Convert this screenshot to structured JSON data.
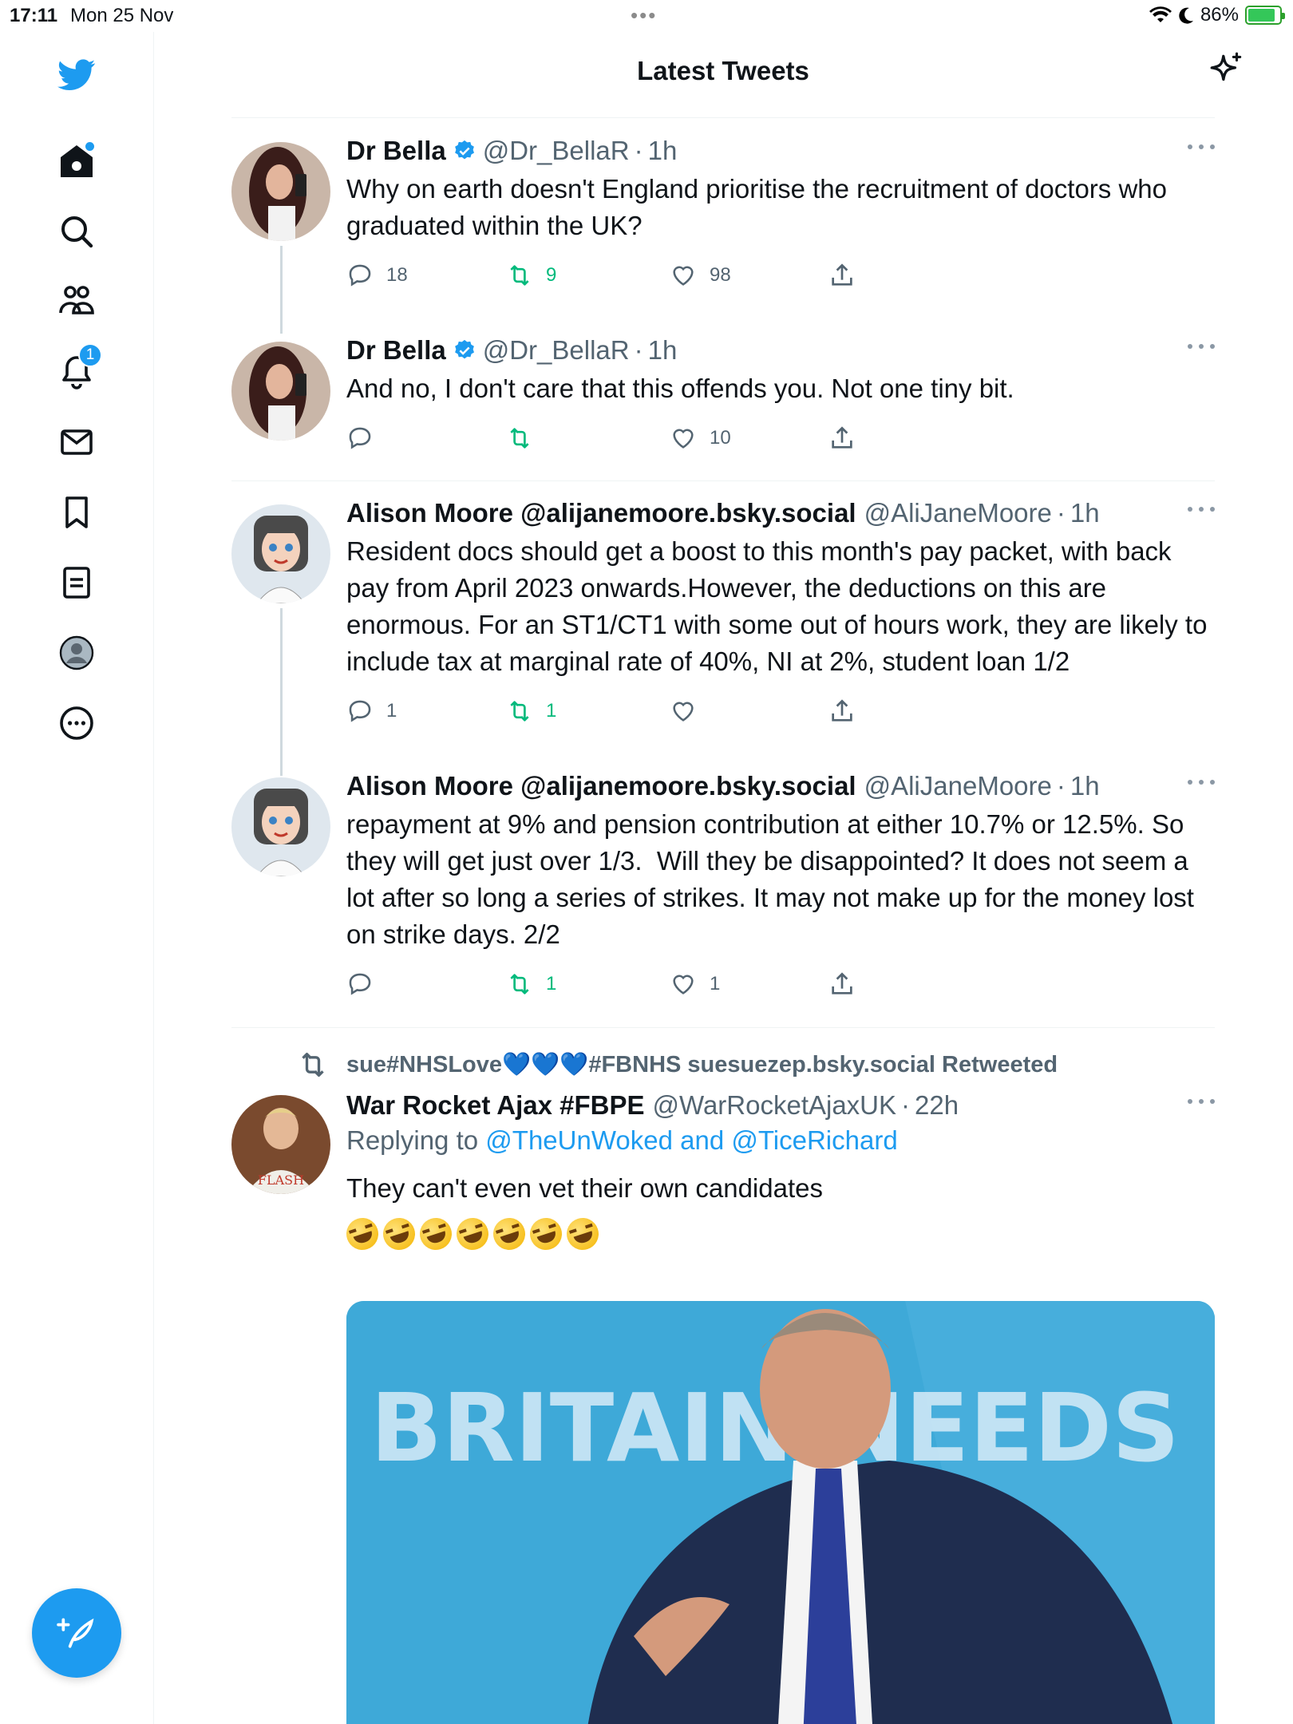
{
  "status_bar": {
    "time": "17:11",
    "date": "Mon 25 Nov",
    "battery": "86%"
  },
  "header": {
    "title": "Latest Tweets"
  },
  "sidebar": {
    "notifications_badge": "1",
    "items": [
      "twitter-logo",
      "home-icon",
      "search-icon",
      "communities-icon",
      "notifications-icon",
      "messages-icon",
      "bookmarks-icon",
      "lists-icon",
      "profile-icon",
      "more-icon"
    ]
  },
  "tweets": [
    {
      "name": "Dr Bella",
      "handle": "@Dr_BellaR",
      "time": "1h",
      "text": "Why on earth doesn't England prioritise the recruitment of doctors who graduated within the UK?",
      "replies": "18",
      "retweets": "9",
      "likes": "98"
    },
    {
      "name": "Dr Bella",
      "handle": "@Dr_BellaR",
      "time": "1h",
      "text": "And no, I don't care that this offends you. Not one tiny bit.",
      "replies": "",
      "retweets": "",
      "likes": "10"
    },
    {
      "name": "Alison Moore @alijanemoore.bsky.social",
      "handle": "@AliJaneMoore",
      "time": "1h",
      "text": "Resident docs should get a boost to this month's pay packet, with back pay from April 2023 onwards.However, the deductions on this are enormous. For an ST1/CT1 with some out of hours work, they are likely to include tax at marginal rate of 40%, NI at 2%, student loan 1/2",
      "replies": "1",
      "retweets": "1",
      "likes": ""
    },
    {
      "name": "Alison Moore @alijanemoore.bsky.social",
      "handle": "@AliJaneMoore",
      "time": "1h",
      "text": "repayment at 9% and pension contribution at either 10.7% or 12.5%. So they will get just over 1/3.  Will they be disappointed? It does not seem a lot after so long a series of strikes. It may not make up for the money lost on strike days. 2/2",
      "replies": "",
      "retweets": "1",
      "likes": "1"
    },
    {
      "retweeted_by": "sue#NHSLove💙💙💙#FBNHS suesuezep.bsky.social Retweeted",
      "name": "War Rocket Ajax #FBPE",
      "handle": "@WarRocketAjaxUK",
      "time": "22h",
      "replying_label": "Replying to",
      "replying_to_1": "@TheUnWoked",
      "replying_and": "and",
      "replying_to_2": "@TiceRichard",
      "text": "They can't even vet their own candidates",
      "emoji_count": 7,
      "media_sign_text": "BRITAIN NEEDS REFO",
      "avatar_shirt_text": "FLASH"
    }
  ],
  "colors": {
    "accent": "#1d9bf0",
    "retweet_green": "#00ba7c",
    "secondary_text": "#536471",
    "divider": "#eff3f4"
  }
}
